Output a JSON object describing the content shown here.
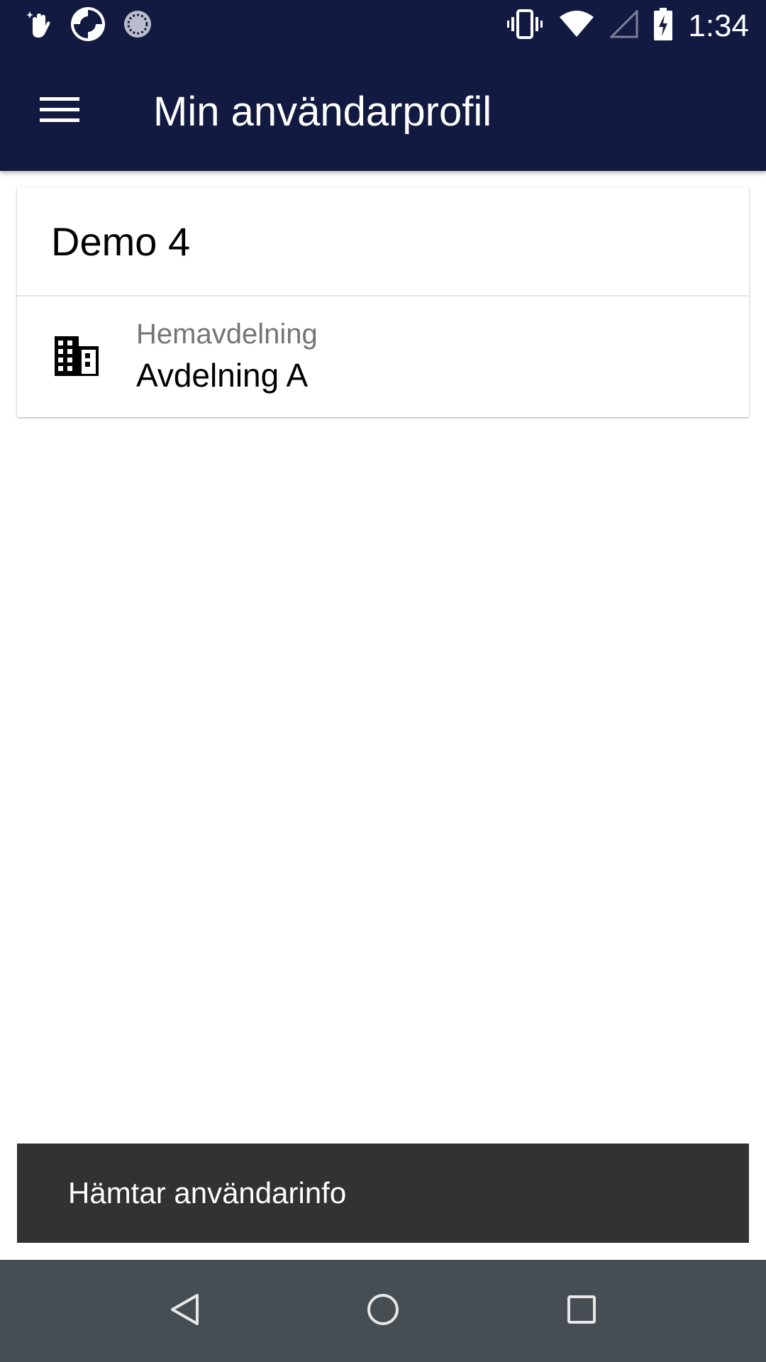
{
  "colors": {
    "primary": "#121a42",
    "snackbar": "#323232",
    "navbar": "#464d53"
  },
  "status_bar": {
    "time": "1:34",
    "left_icons": [
      "hand-sparkle-icon",
      "sync-app-icon",
      "loading-circle-icon"
    ],
    "right_icons": [
      "vibrate-icon",
      "wifi-icon",
      "cell-signal-icon",
      "battery-charging-icon"
    ]
  },
  "app_bar": {
    "title": "Min användarprofil",
    "menu_icon": "hamburger-menu-icon"
  },
  "profile": {
    "name": "Demo 4",
    "department_label": "Hemavdelning",
    "department_value": "Avdelning A",
    "department_icon": "building-icon"
  },
  "snackbar": {
    "message": "Hämtar användarinfo"
  },
  "nav_bar": {
    "icons": [
      "back-triangle-icon",
      "home-circle-icon",
      "recents-square-icon"
    ]
  }
}
